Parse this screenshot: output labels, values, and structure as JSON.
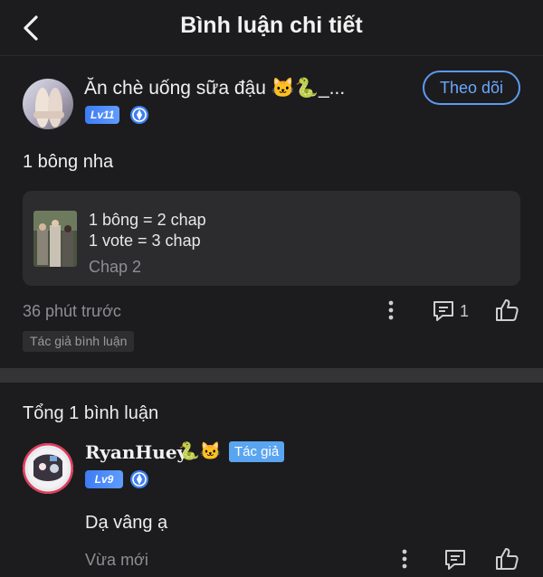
{
  "header": {
    "title": "Bình luận chi tiết",
    "back_icon": "chevron-left-icon"
  },
  "post": {
    "username": "Ăn chè uống sữa đậu 🐱🐍_...",
    "level": "Lv11",
    "follow_label": "Theo dõi",
    "text": "1 bông nha",
    "card": {
      "line1": "1 bông = 2 chap",
      "line2": "1 vote = 3 chap",
      "chapter": "Chap 2"
    },
    "time": "36 phút trước",
    "reply_count": "1",
    "author_tag": "Tác giả bình luận"
  },
  "replies": {
    "total_label": "Tổng 1 bình luận",
    "items": [
      {
        "username": "RyanHuey",
        "emojis": "🐍🐱",
        "author_badge": "Tác giả",
        "level": "Lv9",
        "text": "Dạ vâng ạ",
        "time": "Vừa mới"
      }
    ]
  },
  "colors": {
    "background": "#1c1c1e",
    "accent": "#5a9bf0",
    "card": "#2c2c2e",
    "muted": "#8e8e93"
  }
}
